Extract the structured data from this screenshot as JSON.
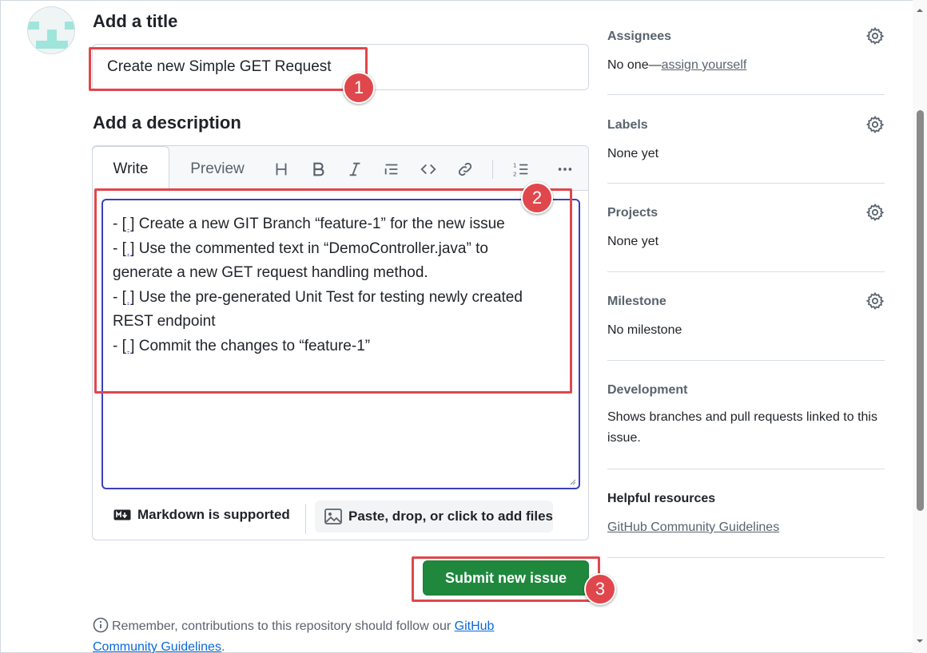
{
  "form": {
    "title_heading": "Add a title",
    "title_value": "Create new Simple GET Request",
    "description_heading": "Add a description",
    "tabs": {
      "write": "Write",
      "preview": "Preview"
    },
    "description_lines": [
      {
        "prefix": "- ",
        "box": "[ ]",
        "text": " Create a new GIT Branch “feature-1” for the new issue"
      },
      {
        "prefix": "- ",
        "box": "[ ]",
        "text": " Use the commented text in “DemoController.java” to"
      },
      {
        "prefix": "",
        "box": "",
        "text": "generate a new GET request handling method."
      },
      {
        "prefix": "- ",
        "box": "[ ]",
        "text": " Use the pre-generated Unit Test for testing newly created"
      },
      {
        "prefix": "",
        "box": "",
        "text": "REST endpoint"
      },
      {
        "prefix": "- ",
        "box": "[ ]",
        "text": " Commit the changes to “feature-1”"
      }
    ],
    "markdown_note": "Markdown is supported",
    "attach_label": "Paste, drop, or click to add files",
    "submit_label": "Submit new issue",
    "note_text": "Remember, contributions to this repository should follow our ",
    "note_link_1": "GitHub",
    "note_link_2": "Community Guidelines",
    "note_end": "."
  },
  "toolbar_icons": [
    "heading-icon",
    "bold-icon",
    "italic-icon",
    "quote-icon",
    "code-icon",
    "link-icon",
    "numbered-list-icon",
    "more-icon"
  ],
  "sidebar": {
    "assignees": {
      "label": "Assignees",
      "value_prefix": "No one—",
      "value_link": "assign yourself"
    },
    "labels": {
      "label": "Labels",
      "value": "None yet"
    },
    "projects": {
      "label": "Projects",
      "value": "None yet"
    },
    "milestone": {
      "label": "Milestone",
      "value": "No milestone"
    },
    "development": {
      "label": "Development",
      "value": "Shows branches and pull requests linked to this issue."
    },
    "resources": {
      "label": "Helpful resources",
      "link": "GitHub Community Guidelines"
    }
  },
  "annotations": [
    "1",
    "2",
    "3"
  ],
  "colors": {
    "submit": "#1f883d",
    "annotation": "#e0474c",
    "focus": "#3a3fbf",
    "link": "#0969da"
  }
}
